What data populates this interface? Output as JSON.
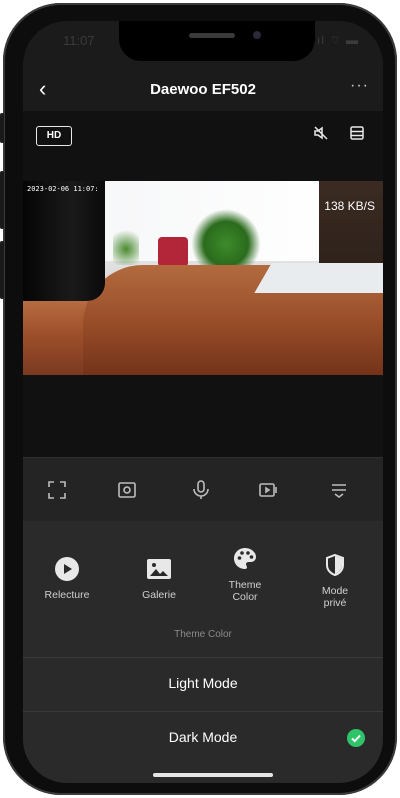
{
  "status_bar": {
    "time": "11:07",
    "right": "..ıl ⌔ ▬"
  },
  "header": {
    "back": "‹",
    "title": "Daewoo EF502",
    "more": "···"
  },
  "video": {
    "quality": "HD",
    "bitrate": "138 KB/S",
    "timestamp": "2023-02-06 11:07:"
  },
  "controls": [
    "fullscreen-icon",
    "snapshot-icon",
    "microphone-icon",
    "record-icon",
    "more-controls-icon"
  ],
  "menu": {
    "items": [
      {
        "label": "Relecture",
        "icon": "play-icon"
      },
      {
        "label": "Galerie",
        "icon": "gallery-icon"
      },
      {
        "label": "Theme\nColor",
        "icon": "palette-icon"
      },
      {
        "label": "Mode\nprivé",
        "icon": "shield-icon"
      }
    ],
    "theme_header": "Theme Color",
    "options": [
      {
        "label": "Light Mode",
        "selected": false
      },
      {
        "label": "Dark Mode",
        "selected": true
      }
    ]
  },
  "colors": {
    "accent_check": "#2fc46a",
    "panel": "#2a2a2a"
  }
}
